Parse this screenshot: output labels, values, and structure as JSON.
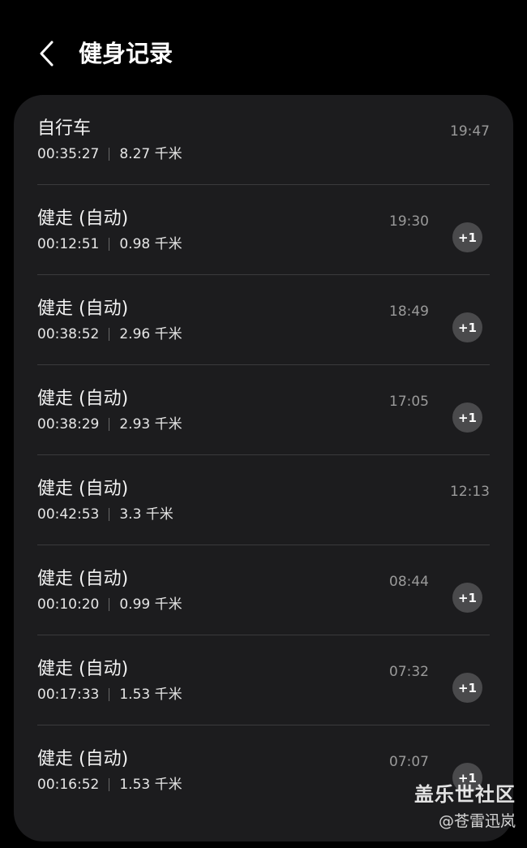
{
  "header": {
    "title": "健身记录",
    "back_icon": "chevron-left-icon"
  },
  "records": [
    {
      "activity": "自行车",
      "duration": "00:35:27",
      "distance": "8.27 千米",
      "time": "19:47",
      "badge": ""
    },
    {
      "activity": "健走 (自动)",
      "duration": "00:12:51",
      "distance": "0.98 千米",
      "time": "19:30",
      "badge": "+1"
    },
    {
      "activity": "健走 (自动)",
      "duration": "00:38:52",
      "distance": "2.96 千米",
      "time": "18:49",
      "badge": "+1"
    },
    {
      "activity": "健走 (自动)",
      "duration": "00:38:29",
      "distance": "2.93 千米",
      "time": "17:05",
      "badge": "+1"
    },
    {
      "activity": "健走 (自动)",
      "duration": "00:42:53",
      "distance": "3.3 千米",
      "time": "12:13",
      "badge": ""
    },
    {
      "activity": "健走 (自动)",
      "duration": "00:10:20",
      "distance": "0.99 千米",
      "time": "08:44",
      "badge": "+1"
    },
    {
      "activity": "健走 (自动)",
      "duration": "00:17:33",
      "distance": "1.53 千米",
      "time": "07:32",
      "badge": "+1"
    },
    {
      "activity": "健走 (自动)",
      "duration": "00:16:52",
      "distance": "1.53 千米",
      "time": "07:07",
      "badge": "+1"
    }
  ],
  "watermark": {
    "brand": "盖乐世社区",
    "author": "@苍雷迅岚"
  },
  "colors": {
    "background": "#000000",
    "card": "#1c1c1e",
    "badge": "#4a4a4c",
    "secondary_text": "#9a9a9a"
  }
}
